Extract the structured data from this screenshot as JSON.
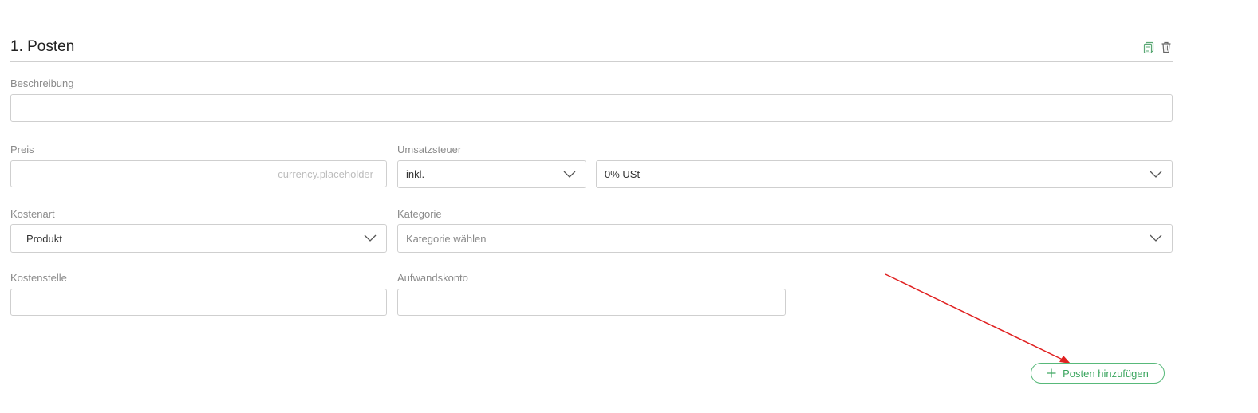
{
  "section": {
    "title": "1. Posten"
  },
  "header_icons": [
    "copy-icon",
    "trash-icon"
  ],
  "fields": {
    "beschreibung": {
      "label": "Beschreibung",
      "value": ""
    },
    "preis": {
      "label": "Preis",
      "placeholder": "currency.placeholder",
      "value": ""
    },
    "umsatzsteuer": {
      "label": "Umsatzsteuer",
      "mode": "inkl.",
      "rate": "0% USt"
    },
    "kostenart": {
      "label": "Kostenart",
      "value": "Produkt"
    },
    "kategorie": {
      "label": "Kategorie",
      "placeholder": "Kategorie wählen"
    },
    "kostenstelle": {
      "label": "Kostenstelle",
      "value": ""
    },
    "aufwandskonto": {
      "label": "Aufwandskonto",
      "value": ""
    }
  },
  "add_button": {
    "label": "Posten hinzufügen",
    "icon": "plus-icon"
  },
  "colors": {
    "accent_green": "#3aa55e",
    "annotation_red": "#e02020",
    "border": "#cfcfcf",
    "label": "#8a8a8a"
  }
}
